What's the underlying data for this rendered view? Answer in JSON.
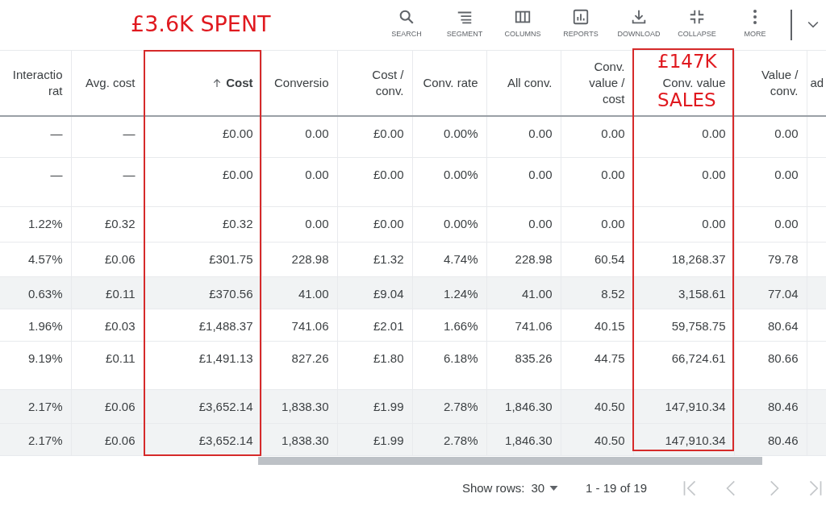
{
  "annotations": [
    {
      "kind": "spent",
      "text": "£3.6K SPENT"
    },
    {
      "kind": "sales-top",
      "text": "£147K"
    },
    {
      "kind": "sales-bottom",
      "text": "SALES"
    }
  ],
  "toolbar": [
    {
      "label": "SEARCH"
    },
    {
      "label": "SEGMENT"
    },
    {
      "label": "COLUMNS"
    },
    {
      "label": "REPORTS"
    },
    {
      "label": "DOWNLOAD"
    },
    {
      "label": "COLLAPSE"
    },
    {
      "label": "MORE"
    }
  ],
  "table": {
    "columns": [
      {
        "lines": [
          "Interactio",
          "rat"
        ],
        "sorted": false
      },
      {
        "lines": [
          "Avg. cost"
        ],
        "sorted": false
      },
      {
        "lines": [
          "Cost"
        ],
        "sorted": true
      },
      {
        "lines": [
          "Conversio"
        ],
        "sorted": false
      },
      {
        "lines": [
          "Cost /",
          "conv."
        ],
        "sorted": false
      },
      {
        "lines": [
          "Conv. rate"
        ],
        "sorted": false
      },
      {
        "lines": [
          "All conv."
        ],
        "sorted": false
      },
      {
        "lines": [
          "Conv.",
          "value /",
          "cost"
        ],
        "sorted": false
      },
      {
        "lines": [
          "Conv. value"
        ],
        "sorted": false
      },
      {
        "lines": [
          "Value /",
          "conv."
        ],
        "sorted": false
      },
      {
        "lines": [
          "ad"
        ],
        "sorted": false
      }
    ],
    "rows": [
      {
        "shaded": false,
        "cells": [
          "—",
          "—",
          "£0.00",
          "0.00",
          "£0.00",
          "0.00%",
          "0.00",
          "0.00",
          "0.00",
          "0.00"
        ]
      },
      {
        "shaded": false,
        "cells": [
          "—",
          "—",
          "£0.00",
          "0.00",
          "£0.00",
          "0.00%",
          "0.00",
          "0.00",
          "0.00",
          "0.00"
        ]
      },
      {
        "shaded": false,
        "cells": [
          "1.22%",
          "£0.32",
          "£0.32",
          "0.00",
          "£0.00",
          "0.00%",
          "0.00",
          "0.00",
          "0.00",
          "0.00"
        ]
      },
      {
        "shaded": false,
        "cells": [
          "4.57%",
          "£0.06",
          "£301.75",
          "228.98",
          "£1.32",
          "4.74%",
          "228.98",
          "60.54",
          "18,268.37",
          "79.78"
        ]
      },
      {
        "shaded": true,
        "cells": [
          "0.63%",
          "£0.11",
          "£370.56",
          "41.00",
          "£9.04",
          "1.24%",
          "41.00",
          "8.52",
          "3,158.61",
          "77.04"
        ]
      },
      {
        "shaded": false,
        "cells": [
          "1.96%",
          "£0.03",
          "£1,488.37",
          "741.06",
          "£2.01",
          "1.66%",
          "741.06",
          "40.15",
          "59,758.75",
          "80.64"
        ]
      },
      {
        "shaded": false,
        "cells": [
          "9.19%",
          "£0.11",
          "£1,491.13",
          "827.26",
          "£1.80",
          "6.18%",
          "835.26",
          "44.75",
          "66,724.61",
          "80.66"
        ]
      },
      {
        "shaded": true,
        "cells": [
          "2.17%",
          "£0.06",
          "£3,652.14",
          "1,838.30",
          "£1.99",
          "2.78%",
          "1,846.30",
          "40.50",
          "147,910.34",
          "80.46"
        ]
      },
      {
        "shaded": true,
        "cells": [
          "2.17%",
          "£0.06",
          "£3,652.14",
          "1,838.30",
          "£1.99",
          "2.78%",
          "1,846.30",
          "40.50",
          "147,910.34",
          "80.46"
        ]
      }
    ]
  },
  "footer": {
    "show_rows_label": "Show rows:",
    "rows_value": "30",
    "range": "1 - 19 of 19"
  }
}
